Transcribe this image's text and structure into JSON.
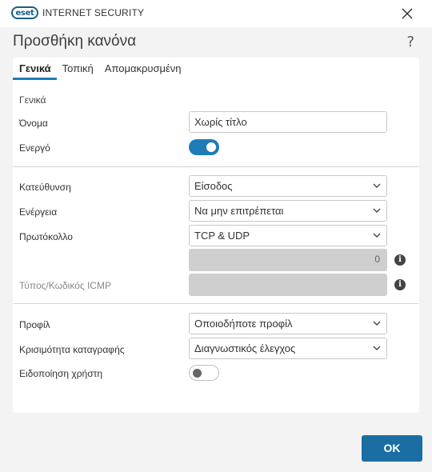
{
  "window": {
    "logo_badge": "eset",
    "product_name": "INTERNET SECURITY",
    "close_icon": "close-icon"
  },
  "dialog": {
    "title": "Προσθήκη κανόνα",
    "help": "?"
  },
  "tabs": [
    {
      "label": "Γενικά",
      "active": true
    },
    {
      "label": "Τοπική",
      "active": false
    },
    {
      "label": "Απομακρυσμένη",
      "active": false
    }
  ],
  "general": {
    "section_label": "Γενικά",
    "name_label": "Όνομα",
    "name_value": "Χωρίς τίτλο",
    "enabled_label": "Ενεργό",
    "enabled": true
  },
  "rule": {
    "direction_label": "Κατεύθυνση",
    "direction_value": "Είσοδος",
    "action_label": "Ενέργεια",
    "action_value": "Να μην επιτρέπεται",
    "protocol_label": "Πρωτόκολλο",
    "protocol_value": "TCP & UDP",
    "protocol_number": "0",
    "icmp_label": "Τύπος/Κωδικός ICMP",
    "icmp_value": ""
  },
  "profile": {
    "profile_label": "Προφίλ",
    "profile_value": "Οποιοδήποτε προφίλ",
    "log_label": "Κρισιμότητα καταγραφής",
    "log_value": "Διαγνωστικός έλεγχος",
    "notify_label": "Ειδοποίηση χρήστη",
    "notify": false
  },
  "buttons": {
    "ok": "OK"
  },
  "colors": {
    "accent": "#1e7cb8",
    "ok_button": "#1a6ea3",
    "disabled_field": "#cfcfcf"
  }
}
